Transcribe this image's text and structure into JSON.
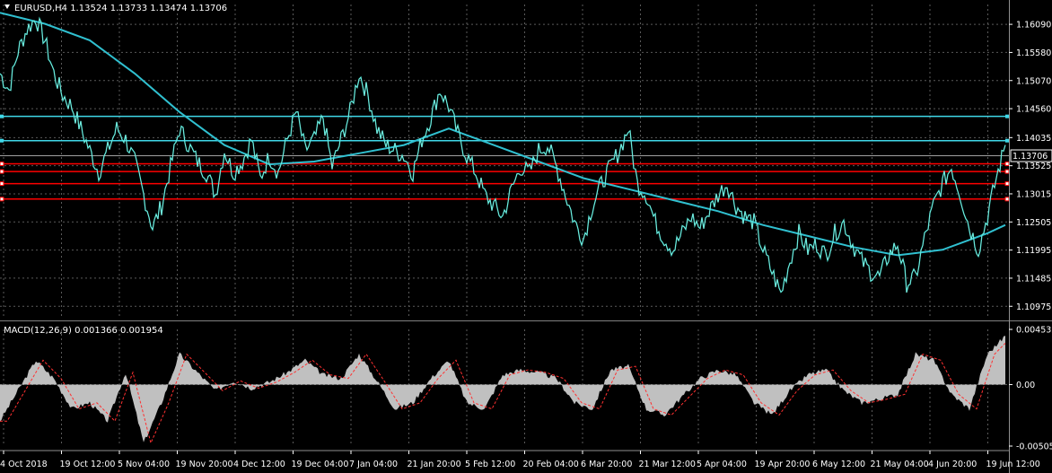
{
  "symbol_header": "EURUSD,H4  1.13524 1.13733 1.13474 1.13706",
  "macd_header": "MACD(12,26,9) 0.001366 0.001954",
  "current_price_label": "1.13706",
  "colors": {
    "background": "#000000",
    "grid": "#5a5a5a",
    "price_line": "#ffffff",
    "candle": "#40e0d0",
    "moving_average": "#30c0d0",
    "support_resistance_cyan": "#40d8e8",
    "support_resistance_red": "#ff0000",
    "macd_histogram": "#c0c0c0",
    "macd_signal": "#ff3030"
  },
  "chart_data": [
    {
      "type": "line",
      "name_ref": "symbol_header",
      "price_axis": {
        "ticks": [
          "1.16090",
          "1.15580",
          "1.15070",
          "1.14560",
          "1.14035",
          "1.13525",
          "1.13015",
          "1.12505",
          "1.11995",
          "1.11485",
          "1.10975"
        ],
        "ylim": [
          1.108,
          1.1645
        ]
      },
      "time_axis": {
        "ticks": [
          "4 Oct 2018",
          "19 Oct 12:00",
          "5 Nov 04:00",
          "19 Nov 20:00",
          "4 Dec 12:00",
          "19 Dec 04:00",
          "7 Jan 04:00",
          "21 Jan 20:00",
          "5 Feb 12:00",
          "20 Feb 04:00",
          "6 Mar 20:00",
          "21 Mar 12:00",
          "5 Apr 04:00",
          "19 Apr 20:00",
          "6 May 12:00",
          "21 May 04:00",
          "4 Jun 20:00",
          "19 Jun 12:00"
        ]
      },
      "price_series": {
        "x": [
          0,
          10,
          20,
          30,
          40,
          50,
          60,
          70,
          80,
          90,
          100,
          110,
          120,
          130,
          140,
          150,
          160,
          170,
          180,
          190,
          200,
          210,
          220,
          230,
          240,
          250,
          260,
          270,
          280,
          290,
          300,
          310,
          320,
          330,
          340,
          350,
          360,
          370,
          380,
          390,
          400,
          410,
          420,
          430,
          440,
          450,
          460,
          470,
          480,
          490,
          500,
          510,
          520,
          530,
          540,
          550,
          560,
          570,
          580,
          590,
          600,
          610,
          620,
          630,
          640,
          650,
          660,
          670,
          680,
          690,
          700,
          710,
          720,
          730,
          740,
          750,
          760,
          770,
          780,
          790,
          800,
          810,
          820,
          830,
          840,
          850,
          860,
          870,
          880,
          890,
          900,
          910,
          920,
          930,
          940,
          950,
          960,
          970,
          980,
          990,
          1000,
          1010,
          1020,
          1030,
          1040,
          1050,
          1060,
          1070,
          1080,
          1090,
          1100,
          1110,
          1120
        ],
        "y": [
          1.152,
          1.149,
          1.156,
          1.16,
          1.162,
          1.158,
          1.152,
          1.148,
          1.146,
          1.142,
          1.138,
          1.134,
          1.138,
          1.142,
          1.14,
          1.136,
          1.13,
          1.124,
          1.128,
          1.135,
          1.142,
          1.139,
          1.136,
          1.134,
          1.13,
          1.138,
          1.134,
          1.136,
          1.14,
          1.133,
          1.137,
          1.134,
          1.14,
          1.145,
          1.138,
          1.14,
          1.144,
          1.135,
          1.14,
          1.145,
          1.152,
          1.148,
          1.142,
          1.139,
          1.138,
          1.137,
          1.134,
          1.14,
          1.144,
          1.149,
          1.146,
          1.141,
          1.137,
          1.134,
          1.13,
          1.128,
          1.126,
          1.131,
          1.135,
          1.134,
          1.138,
          1.139,
          1.135,
          1.13,
          1.125,
          1.122,
          1.128,
          1.132,
          1.135,
          1.138,
          1.142,
          1.132,
          1.13,
          1.125,
          1.122,
          1.12,
          1.123,
          1.126,
          1.124,
          1.127,
          1.13,
          1.132,
          1.128,
          1.126,
          1.125,
          1.12,
          1.116,
          1.112,
          1.118,
          1.123,
          1.12,
          1.121,
          1.119,
          1.123,
          1.125,
          1.121,
          1.118,
          1.116,
          1.115,
          1.119,
          1.121,
          1.114,
          1.115,
          1.122,
          1.128,
          1.132,
          1.135,
          1.13,
          1.124,
          1.12,
          1.126,
          1.133,
          1.139
        ]
      },
      "moving_average_series": {
        "x": [
          0,
          50,
          100,
          150,
          200,
          250,
          300,
          350,
          400,
          450,
          500,
          550,
          600,
          650,
          700,
          750,
          800,
          850,
          900,
          950,
          1000,
          1050,
          1100,
          1120
        ],
        "y": [
          1.163,
          1.161,
          1.158,
          1.152,
          1.145,
          1.139,
          1.1355,
          1.136,
          1.1375,
          1.139,
          1.142,
          1.139,
          1.136,
          1.133,
          1.131,
          1.129,
          1.127,
          1.1245,
          1.1225,
          1.1205,
          1.119,
          1.12,
          1.123,
          1.1245
        ]
      },
      "horizontal_levels": {
        "cyan": [
          1.1442,
          1.1398
        ],
        "red": [
          1.1356,
          1.1342,
          1.132,
          1.1292
        ]
      },
      "current_price": 1.13706
    },
    {
      "type": "bar",
      "name_ref": "macd_header",
      "value_axis": {
        "ticks": [
          "0.004532",
          "0.00",
          "-0.005051"
        ],
        "ylim": [
          -0.005051,
          0.004532
        ]
      },
      "histogram": {
        "x": [
          0,
          20,
          40,
          60,
          80,
          100,
          120,
          140,
          160,
          180,
          200,
          220,
          240,
          260,
          280,
          300,
          320,
          340,
          360,
          380,
          400,
          420,
          440,
          460,
          480,
          500,
          520,
          540,
          560,
          580,
          600,
          620,
          640,
          660,
          680,
          700,
          720,
          740,
          760,
          780,
          800,
          820,
          840,
          860,
          880,
          900,
          920,
          940,
          960,
          980,
          1000,
          1020,
          1040,
          1060,
          1080,
          1100,
          1120
        ],
        "values": [
          -0.003,
          -0.0005,
          0.002,
          0.0005,
          -0.002,
          -0.0015,
          -0.003,
          0.001,
          -0.0048,
          -0.0015,
          0.0025,
          0.001,
          -0.0005,
          0.0003,
          -0.0003,
          0.0002,
          0.001,
          0.002,
          0.0008,
          0.0005,
          0.0025,
          0.0003,
          -0.002,
          -0.0015,
          0.0005,
          0.002,
          -0.0015,
          -0.002,
          0.0008,
          0.0012,
          0.001,
          0.0005,
          -0.0015,
          -0.002,
          0.0012,
          0.0015,
          -0.002,
          -0.0025,
          -0.001,
          0.0005,
          0.0012,
          0.0008,
          -0.0015,
          -0.0025,
          -0.0005,
          0.0008,
          0.0012,
          -0.0005,
          -0.0015,
          -0.0012,
          -0.0008,
          0.0025,
          0.002,
          -0.0008,
          -0.002,
          0.0025,
          0.004
        ]
      }
    }
  ]
}
